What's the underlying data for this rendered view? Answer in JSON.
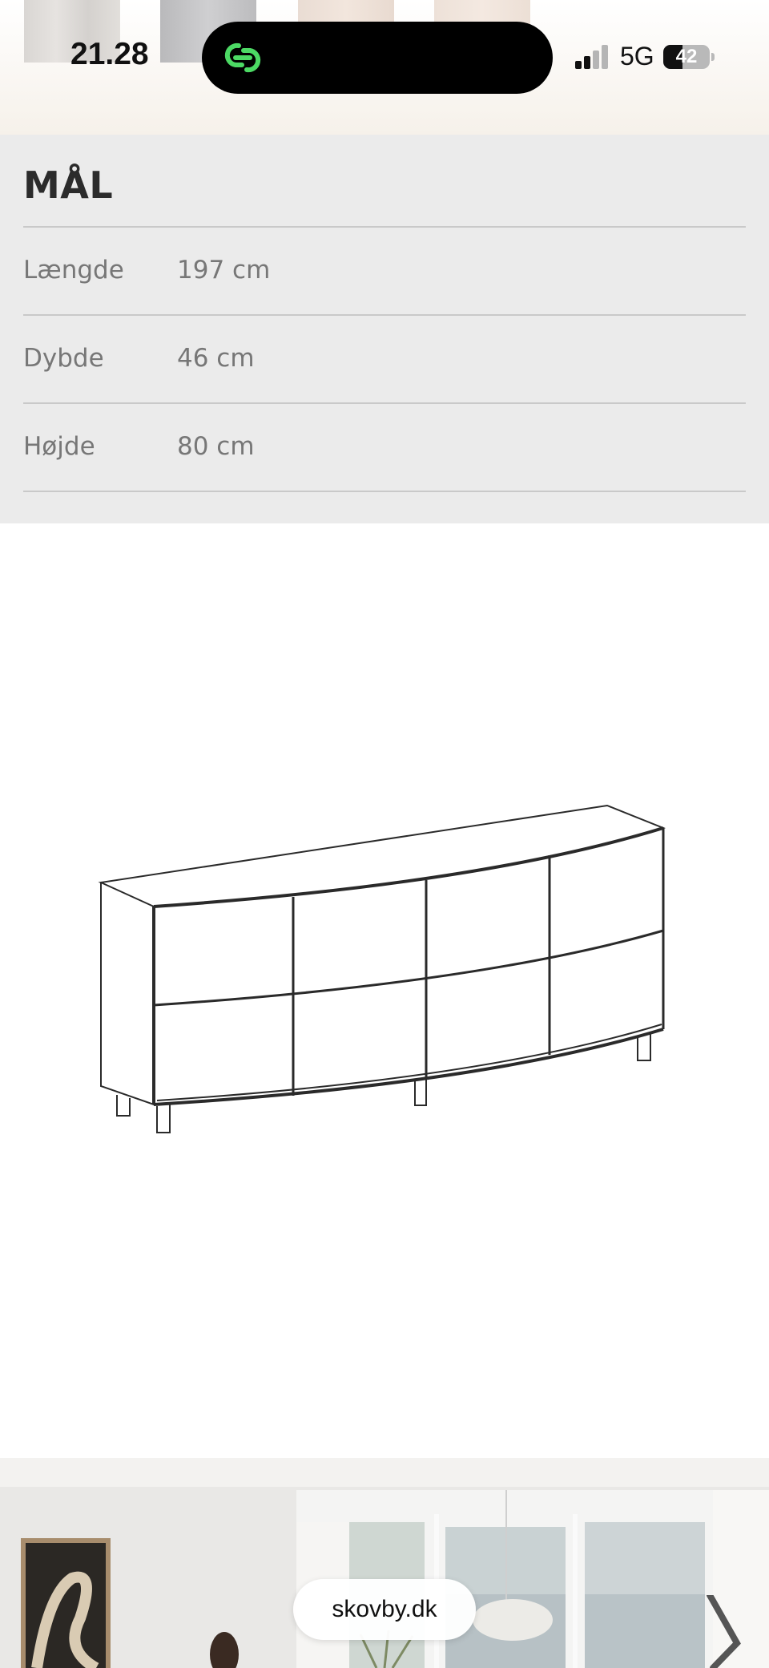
{
  "status_bar": {
    "time": "21.28",
    "network": "5G",
    "battery": "42",
    "battery_level": 0.42
  },
  "dimensions": {
    "title": "MÅL",
    "rows": [
      {
        "label": "Længde",
        "value": "197 cm"
      },
      {
        "label": "Dybde",
        "value": "46 cm"
      },
      {
        "label": "Højde",
        "value": "80 cm"
      }
    ]
  },
  "browser": {
    "url": "skovby.dk"
  },
  "icons": {
    "island": "link-icon",
    "next": "chevron-right-icon"
  },
  "colors": {
    "section_bg": "#ebebeb",
    "link_green": "#4cd964"
  }
}
